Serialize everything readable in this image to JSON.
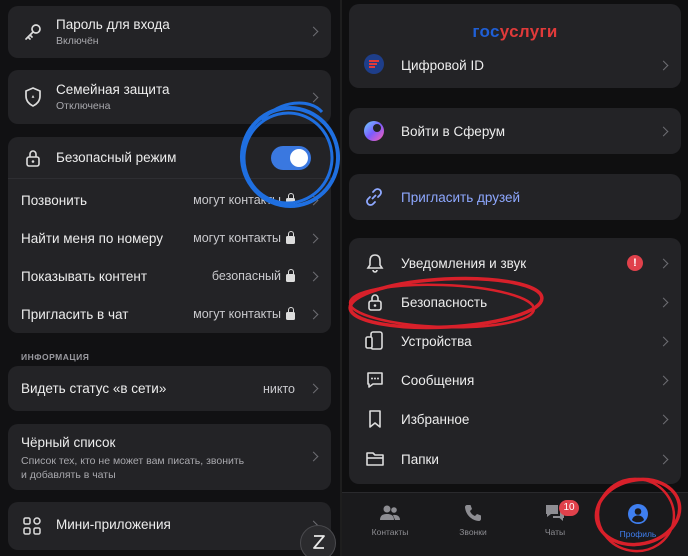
{
  "left": {
    "password": {
      "title": "Пароль для входа",
      "subtitle": "Включён"
    },
    "family": {
      "title": "Семейная защита",
      "subtitle": "Отключена"
    },
    "safe_mode": {
      "title": "Безопасный режим",
      "toggle_on": true,
      "rows": [
        {
          "label": "Позвонить",
          "value": "могут контакты"
        },
        {
          "label": "Найти меня по номеру",
          "value": "могут контакты"
        },
        {
          "label": "Показывать контент",
          "value": "безопасный"
        },
        {
          "label": "Пригласить в чат",
          "value": "могут контакты"
        }
      ]
    },
    "section_info": "ИНФОРМАЦИЯ",
    "online_status": {
      "label": "Видеть статус «в сети»",
      "value": "никто"
    },
    "blacklist": {
      "title": "Чёрный список",
      "subtitle_line1": "Список тех, кто не может вам писать, звонить",
      "subtitle_line2": "и добавлять в чаты"
    },
    "mini_apps": {
      "title": "Мини-приложения"
    }
  },
  "right": {
    "brand": {
      "part1": "гос",
      "part2": "услуги"
    },
    "digital_id": "Цифровой ID",
    "sferum": "Войти в Сферум",
    "invite": "Пригласить друзей",
    "settings": [
      {
        "label": "Уведомления и звук",
        "alert": "!"
      },
      {
        "label": "Безопасность"
      },
      {
        "label": "Устройства"
      },
      {
        "label": "Сообщения"
      },
      {
        "label": "Избранное"
      },
      {
        "label": "Папки"
      }
    ],
    "tabs": [
      {
        "label": "Контакты"
      },
      {
        "label": "Звонки"
      },
      {
        "label": "Чаты",
        "badge": "10"
      },
      {
        "label": "Профиль",
        "active": true
      }
    ]
  },
  "colors": {
    "accent": "#3f7ff0",
    "toggle": "#3a78e0",
    "annotation_blue": "#1f6fe0",
    "annotation_red": "#d8202a",
    "invite_text": "#8ea8ff",
    "alert": "#e0414b"
  }
}
